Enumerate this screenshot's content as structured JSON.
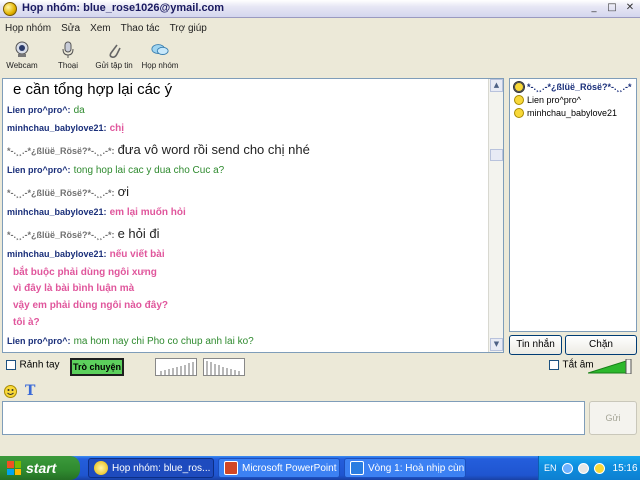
{
  "window": {
    "title": "Họp nhóm:  blue_rose1026@ymail.com",
    "app_icon": "yahoo-smiley-icon",
    "controls": [
      "_",
      "□",
      "✕"
    ]
  },
  "menu": [
    "Họp nhóm",
    "Sửa",
    "Xem",
    "Thao tác",
    "Trợ giúp"
  ],
  "toolbar": [
    {
      "label": "Webcam",
      "icon": "webcam-icon"
    },
    {
      "label": "Thoại",
      "icon": "microphone-icon"
    },
    {
      "label": "Gửi tập tin",
      "icon": "paperclip-icon"
    },
    {
      "label": "Họp nhóm",
      "icon": "conference-icon"
    }
  ],
  "chat": {
    "colors": {
      "lien": "#2e8a2e",
      "minhchau": "#e0569c",
      "blue_rose": "#707070",
      "nick_blue": "#1a2f7a"
    },
    "messages": [
      {
        "nick": "",
        "text": "e cần tổng hợp lại các ý",
        "style": "big"
      },
      {
        "nick": "Lien pro^pro^:",
        "text": "da",
        "style": "lien"
      },
      {
        "nick": "minhchau_babylove21:",
        "text": "chị",
        "style": "pink"
      },
      {
        "nick": "*-.¸¸.-*¿ßlüë_Rösë?*-.¸¸.-*:",
        "text": "đưa vô word rồi send cho chị nhé",
        "style": "big-gray"
      },
      {
        "nick": "Lien pro^pro^:",
        "text": "tong hop lai cac y dua cho Cuc a?",
        "style": "lien"
      },
      {
        "nick": "*-.¸¸.-*¿ßlüë_Rösë?*-.¸¸.-*:",
        "text": "ơi",
        "style": "big-gray"
      },
      {
        "nick": "minhchau_babylove21:",
        "text": "em lại muốn hỏi",
        "style": "pink"
      },
      {
        "nick": "*-.¸¸.-*¿ßlüë_Rösë?*-.¸¸.-*:",
        "text": "e hỏi đi",
        "style": "big-gray"
      },
      {
        "nick": "minhchau_babylove21:",
        "text": "nếu viết bài",
        "style": "pink"
      },
      {
        "nick": "",
        "text": "bắt buộc phải dùng ngôi xưng",
        "style": "pink-cont"
      },
      {
        "nick": "",
        "text": "vì đây là bài bình luận mà",
        "style": "pink-cont"
      },
      {
        "nick": "",
        "text": "vậy em phải dùng ngôi nào đây?",
        "style": "pink-cont"
      },
      {
        "nick": "",
        "text": "tôi à?",
        "style": "pink-cont"
      },
      {
        "nick": "Lien pro^pro^:",
        "text": "ma hom nay chi Pho co chup anh lai ko?",
        "style": "lien"
      }
    ]
  },
  "members": [
    {
      "name": "*-.¸¸.-*¿ßlüë_Rösë?*-.¸¸.-*",
      "icon": "webcam-smiley-icon"
    },
    {
      "name": "Lien pro^pro^",
      "icon": "smiley-icon"
    },
    {
      "name": "minhchau_babylove21",
      "icon": "smiley-icon"
    }
  ],
  "buttons": {
    "message": "Tin nhắn",
    "block": "Chặn",
    "send": "Gửi"
  },
  "controls": {
    "hands_free": "Rảnh tay",
    "talk": "Trò chuyện",
    "mute": "Tắt âm"
  },
  "format": {
    "emoticon_icon": "emoticon-icon",
    "text_icon": "text-format-icon"
  },
  "taskbar": {
    "start": "start",
    "tasks": [
      {
        "label": "Họp nhóm:  blue_ros...",
        "icon": "yahoo-smiley-icon",
        "active": true
      },
      {
        "label": "Microsoft PowerPoint ...",
        "icon": "powerpoint-icon",
        "active": false
      },
      {
        "label": "Vòng 1: Hoà nhịp cùn...",
        "icon": "ie-icon",
        "active": false
      }
    ],
    "language": "EN",
    "tray_icons": [
      "network-icon",
      "volume-icon",
      "yahoo-tray-icon"
    ],
    "clock": "15:16"
  }
}
